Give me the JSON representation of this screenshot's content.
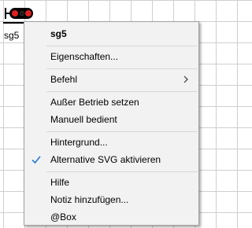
{
  "canvas": {
    "element_label": "sg5",
    "element_icon": "signal-icon"
  },
  "menu": {
    "header": "sg5",
    "items": [
      {
        "label": "Eigenschaften...",
        "checked": false,
        "submenu": false
      },
      {
        "label": "Befehl",
        "checked": false,
        "submenu": true
      },
      {
        "label": "Außer Betrieb setzen",
        "checked": false,
        "submenu": false
      },
      {
        "label": "Manuell bedient",
        "checked": false,
        "submenu": false
      },
      {
        "label": "Hintergrund...",
        "checked": false,
        "submenu": false
      },
      {
        "label": "Alternative SVG aktivieren",
        "checked": true,
        "submenu": false
      },
      {
        "label": "Hilfe",
        "checked": false,
        "submenu": false
      },
      {
        "label": "Notiz hinzufügen...",
        "checked": false,
        "submenu": false
      },
      {
        "label": "@Box",
        "checked": false,
        "submenu": false
      }
    ],
    "check_icon": "checkmark-icon",
    "submenu_icon": "chevron-right-icon"
  },
  "colors": {
    "menu_bg": "#f2f2f2",
    "check": "#2a7ad4",
    "signal_red": "#e02020",
    "signal_dark": "#000000"
  }
}
